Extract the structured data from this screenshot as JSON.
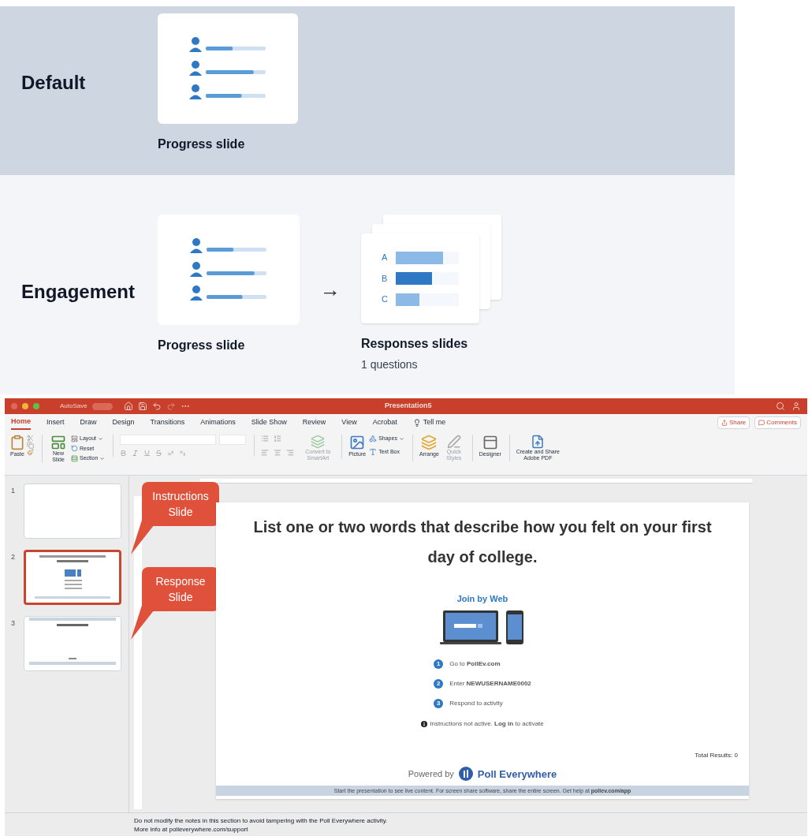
{
  "modes": [
    {
      "title": "Default",
      "slides": [
        {
          "kind": "progress",
          "label": "Progress slide"
        }
      ]
    },
    {
      "title": "Engagement",
      "slides": [
        {
          "kind": "progress",
          "label": "Progress slide"
        },
        {
          "kind": "arrow",
          "text": "→"
        },
        {
          "kind": "responses",
          "label": "Responses slides",
          "sublabel": "1 questions",
          "bars": [
            {
              "label": "A",
              "level": 0.75
            },
            {
              "label": "B",
              "level": 0.58
            },
            {
              "label": "C",
              "level": 0.37
            }
          ]
        }
      ]
    }
  ],
  "app": {
    "title_bar": {
      "autosave": "AutoSave",
      "title": "Presentation5"
    },
    "tabs": [
      {
        "label": "Home",
        "selected": true
      },
      {
        "label": "Insert",
        "selected": false
      },
      {
        "label": "Draw",
        "selected": false
      },
      {
        "label": "Design",
        "selected": false
      },
      {
        "label": "Transitions",
        "selected": false
      },
      {
        "label": "Animations",
        "selected": false
      },
      {
        "label": "Slide Show",
        "selected": false
      },
      {
        "label": "Review",
        "selected": false
      },
      {
        "label": "View",
        "selected": false
      },
      {
        "label": "Acrobat",
        "selected": false
      }
    ],
    "tell_me": "Tell me",
    "share": "Share",
    "comments": "Comments",
    "ribbon": {
      "paste": "Paste",
      "new_slide": "New Slide",
      "layout": "Layout",
      "reset": "Reset",
      "section": "Section",
      "smartart": {
        "label": "Convert to SmartArt",
        "disabled": true
      },
      "picture": "Picture",
      "shapes": "Shapes",
      "text_box": "Text Box",
      "arrange": "Arrange",
      "quick_styles": {
        "label": "Quick Styles",
        "disabled": true
      },
      "designer": "Designer",
      "adobe_pdf": "Create and Share Adobe PDF"
    },
    "thumbnails": [
      {
        "number": "1",
        "kind": "blank",
        "selected": false
      },
      {
        "number": "2",
        "kind": "instructions",
        "selected": true
      },
      {
        "number": "3",
        "kind": "response",
        "selected": false
      }
    ],
    "callouts": [
      {
        "text": "Instructions Slide"
      },
      {
        "text": "Response Slide"
      }
    ],
    "slide": {
      "title": "List one or two words that describe how you felt on your first day of college.",
      "join": "Join by Web",
      "steps": [
        {
          "number": "1",
          "text": "Go to **PollEv.com**"
        },
        {
          "number": "2",
          "text": "Enter **NEWUSERNAME0002**"
        },
        {
          "number": "3",
          "text": "Respond to activity"
        }
      ],
      "notice": "Instructions not active. **Log in** to activate",
      "total": "Total Results: 0",
      "powered_by": "Powered by",
      "brand": "Poll Everywhere",
      "footer": "Start the presentation to see live content. For screen share software, share the entire screen. Get help at **pollev.com/app**"
    },
    "notes": [
      "Do not modify the notes in this section to avoid tampering with the Poll Everywhere activity.",
      "More info at polleverywhere.com/support"
    ]
  }
}
